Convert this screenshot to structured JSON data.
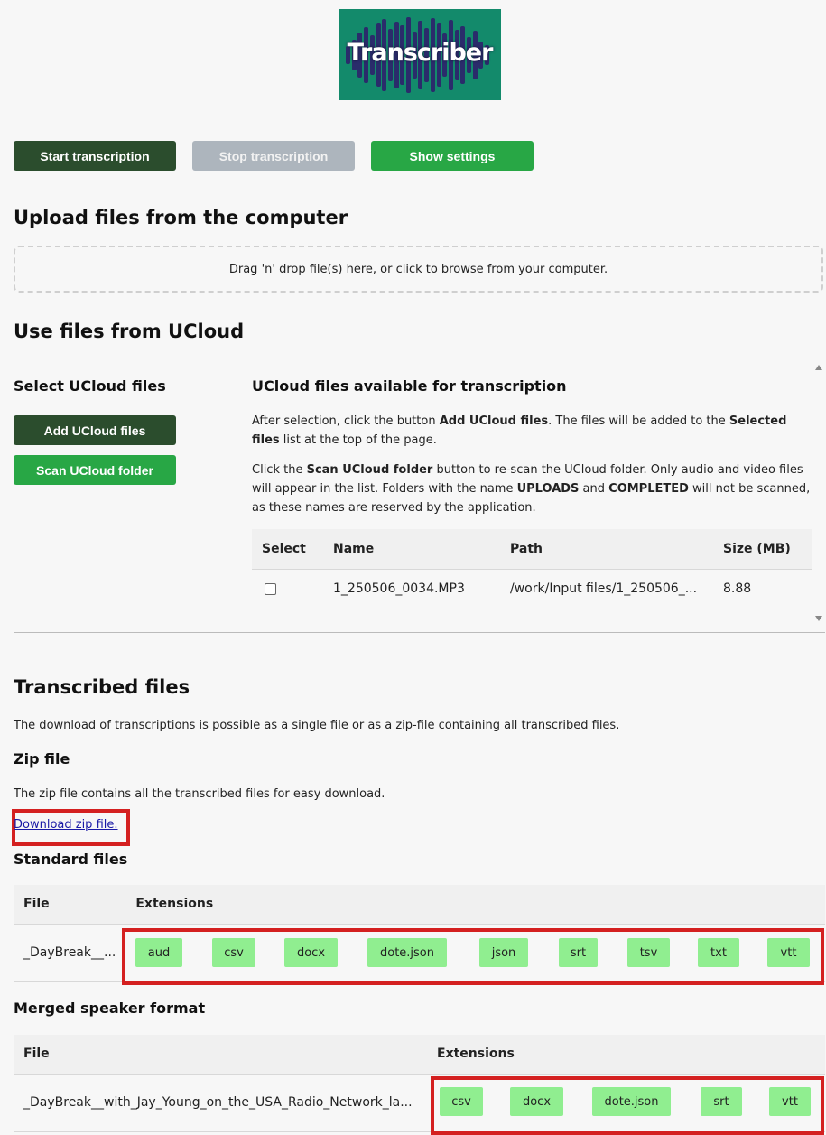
{
  "logo": {
    "text": "Transcriber"
  },
  "toolbar": {
    "start_label": "Start transcription",
    "stop_label": "Stop transcription",
    "settings_label": "Show settings"
  },
  "upload": {
    "heading": "Upload files from the computer",
    "dropzone_text": "Drag 'n' drop file(s) here, or click to browse from your computer."
  },
  "ucloud": {
    "heading": "Use files from UCloud",
    "select_heading": "Select UCloud files",
    "add_label": "Add UCloud files",
    "scan_label": "Scan UCloud folder",
    "available_heading": "UCloud files available for transcription",
    "para1": {
      "a": "After selection, click the button ",
      "b": "Add UCloud files",
      "c": ". The files will be added to the ",
      "d": "Selected files",
      "e": " list at the top of the page."
    },
    "para2": {
      "a": "Click the ",
      "b": "Scan UCloud folder",
      "c": " button to re-scan the UCloud folder. Only audio and video files will appear in the list. Folders with the name ",
      "d": "UPLOADS",
      "e": " and ",
      "f": "COMPLETED",
      "g": " will not be scanned, as these names are reserved by the application."
    },
    "table": {
      "headers": [
        "Select",
        "Name",
        "Path",
        "Size (MB)"
      ],
      "rows": [
        {
          "name": "1_250506_0034.MP3",
          "path": "/work/Input files/1_250506_...",
          "size": "8.88"
        }
      ]
    }
  },
  "transcribed": {
    "heading": "Transcribed files",
    "intro": "The download of transcriptions is possible as a single file or as a zip-file containing all transcribed files.",
    "zip_heading": "Zip file",
    "zip_text": "The zip file contains all the transcribed files for easy download.",
    "zip_link": "Download zip file.",
    "standard_heading": "Standard files",
    "standard_table": {
      "headers": [
        "File",
        "Extensions"
      ],
      "file": "_DayBreak__...",
      "extensions": [
        "aud",
        "csv",
        "docx",
        "dote.json",
        "json",
        "srt",
        "tsv",
        "txt",
        "vtt"
      ]
    },
    "merged_heading": "Merged speaker format",
    "merged_table": {
      "headers": [
        "File",
        "Extensions"
      ],
      "file": "_DayBreak__with_Jay_Young_on_the_USA_Radio_Network_la...",
      "extensions": [
        "csv",
        "docx",
        "dote.json",
        "srt",
        "vtt"
      ]
    }
  },
  "colors": {
    "highlight": "#d42020",
    "extension_chip": "#90ee90",
    "primary_dark": "#2b4d2d",
    "primary_green": "#28a745",
    "logo_bg": "#138a6b"
  }
}
